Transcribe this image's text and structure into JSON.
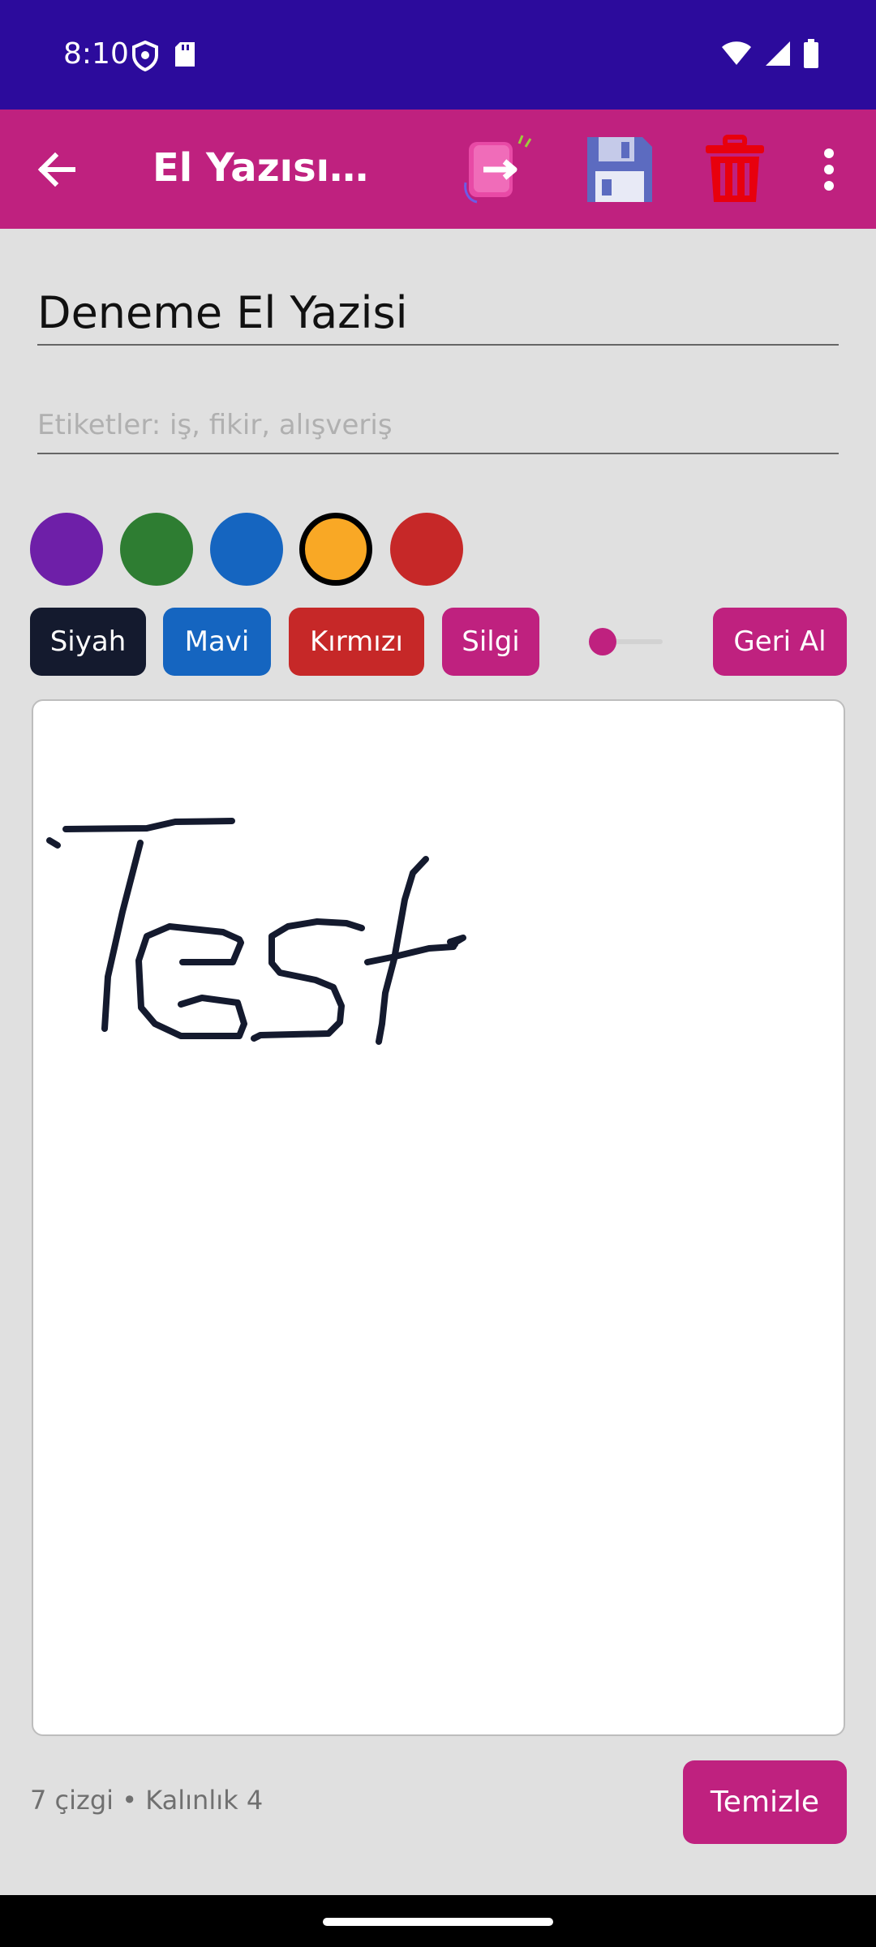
{
  "status_bar": {
    "time": "8:10",
    "icons_left": [
      "shield-icon",
      "sd-card-icon"
    ],
    "icons_right": [
      "wifi-icon",
      "signal-icon",
      "battery-icon"
    ]
  },
  "app_bar": {
    "title": "El Yazısını...",
    "color": "#bf217f",
    "actions": [
      "export-icon",
      "save-icon",
      "delete-icon",
      "more-icon"
    ]
  },
  "form": {
    "title_value": "Deneme El Yazisi",
    "tags_placeholder": "Etiketler: iş, fikir, alışveriş"
  },
  "swatches": [
    {
      "name": "purple",
      "color": "#6e1fa8",
      "selected": false
    },
    {
      "name": "green",
      "color": "#2e7d32",
      "selected": false
    },
    {
      "name": "blue",
      "color": "#1565c0",
      "selected": false
    },
    {
      "name": "orange",
      "color": "#f9a825",
      "selected": true
    },
    {
      "name": "red",
      "color": "#c62828",
      "selected": false
    }
  ],
  "tools": {
    "black": "Siyah",
    "blue": "Mavi",
    "red": "Kırmızı",
    "eraser": "Silgi",
    "undo": "Geri Al"
  },
  "stroke_width": 4,
  "canvas_text": "Test",
  "footer": {
    "status": "7 çizgi • Kalınlık 4",
    "clear": "Temizle"
  }
}
